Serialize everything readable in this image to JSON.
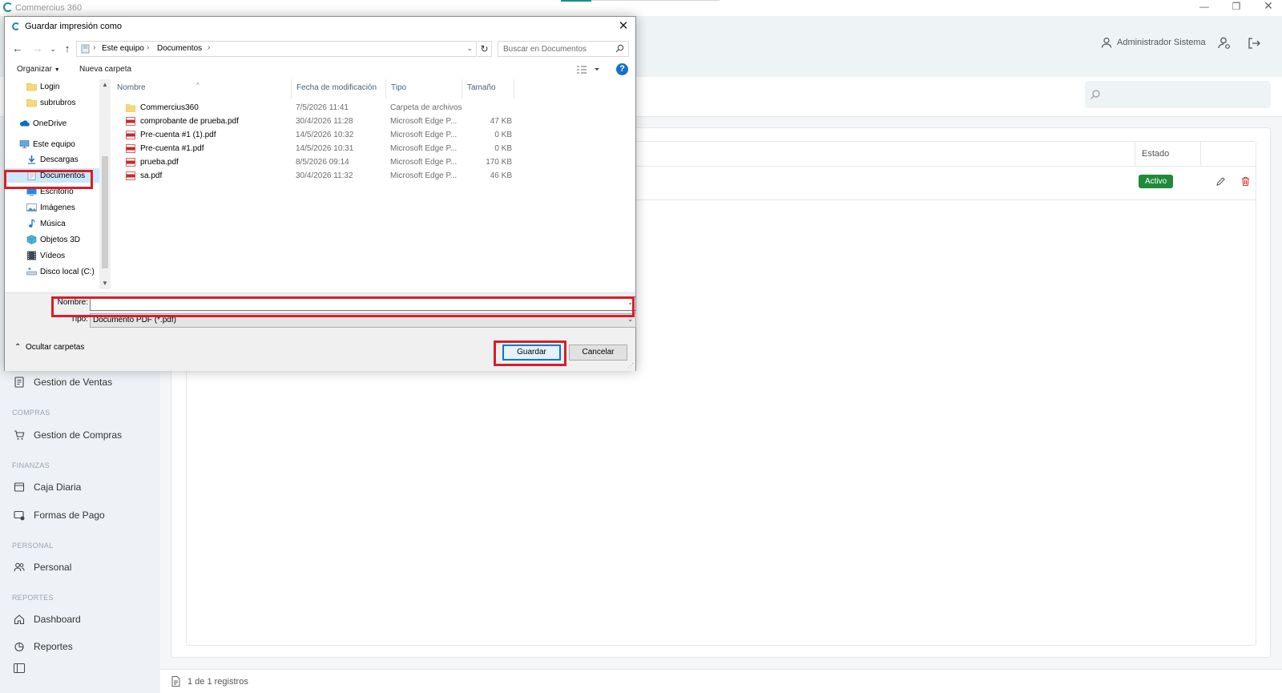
{
  "app": {
    "window_title": "Commercius 360",
    "user_name": "Administrador Sistema"
  },
  "sidebar": {
    "items": [
      {
        "label": "Gestion de Ventas"
      },
      {
        "section": "COMPRAS"
      },
      {
        "label": "Gestion de Compras"
      },
      {
        "section": "FINANZAS"
      },
      {
        "label": "Caja Diaria"
      },
      {
        "label": "Formas de Pago"
      },
      {
        "section": "PERSONAL"
      },
      {
        "label": "Personal"
      },
      {
        "section": "REPORTES"
      },
      {
        "label": "Dashboard"
      },
      {
        "label": "Reportes"
      }
    ]
  },
  "table": {
    "headers": {
      "estado": "Estado"
    },
    "rows": [
      {
        "estado": "Activo"
      }
    ],
    "footer": "1 de 1 registros"
  },
  "dialog": {
    "title": "Guardar impresión como",
    "address": {
      "crumbs": [
        "Este equipo",
        "Documentos"
      ]
    },
    "search_placeholder": "Buscar en Documentos",
    "toolbar": {
      "organize": "Organizar",
      "new_folder": "Nueva carpeta"
    },
    "tree": [
      {
        "label": "Login",
        "icon": "folder-icon"
      },
      {
        "label": "subrubros",
        "icon": "folder-icon"
      },
      {
        "label": "OneDrive",
        "icon": "cloud-icon"
      },
      {
        "label": "Este equipo",
        "icon": "computer-icon"
      },
      {
        "label": "Descargas",
        "icon": "download-icon"
      },
      {
        "label": "Documentos",
        "icon": "documents-icon",
        "selected": true
      },
      {
        "label": "Escritorio",
        "icon": "desktop-icon"
      },
      {
        "label": "Imágenes",
        "icon": "images-icon"
      },
      {
        "label": "Música",
        "icon": "music-icon"
      },
      {
        "label": "Objetos 3D",
        "icon": "cube-icon"
      },
      {
        "label": "Vídeos",
        "icon": "video-icon"
      },
      {
        "label": "Disco local (C:)",
        "icon": "drive-icon"
      }
    ],
    "columns": {
      "name": "Nombre",
      "modified": "Fecha de modificación",
      "type": "Tipo",
      "size": "Tamaño"
    },
    "files": [
      {
        "name": "Commercius360",
        "modified": "7/5/2026 11:41",
        "type": "Carpeta de archivos",
        "size": "",
        "icon": "folder-icon"
      },
      {
        "name": "comprobante de prueba.pdf",
        "modified": "30/4/2026 11:28",
        "type": "Microsoft Edge P...",
        "size": "47 KB",
        "icon": "pdf-icon"
      },
      {
        "name": "Pre-cuenta #1 (1).pdf",
        "modified": "14/5/2026 10:32",
        "type": "Microsoft Edge P...",
        "size": "0 KB",
        "icon": "pdf-icon"
      },
      {
        "name": "Pre-cuenta #1.pdf",
        "modified": "14/5/2026 10:31",
        "type": "Microsoft Edge P...",
        "size": "0 KB",
        "icon": "pdf-icon"
      },
      {
        "name": "prueba.pdf",
        "modified": "8/5/2026 09:14",
        "type": "Microsoft Edge P...",
        "size": "170 KB",
        "icon": "pdf-icon"
      },
      {
        "name": "sa.pdf",
        "modified": "30/4/2026 11:32",
        "type": "Microsoft Edge P...",
        "size": "46 KB",
        "icon": "pdf-icon"
      }
    ],
    "filename_label": "Nombre:",
    "filename_value": "",
    "type_label": "Tipo:",
    "type_value": "Documento PDF (*.pdf)",
    "hide_folders": "Ocultar carpetas",
    "save_button": "Guardar",
    "cancel_button": "Cancelar"
  },
  "colors": {
    "accent": "#1a8f8f",
    "status_active": "#1e8a3a",
    "highlight": "#d71e28",
    "selection": "#cce8ff",
    "help": "#1570c9"
  }
}
